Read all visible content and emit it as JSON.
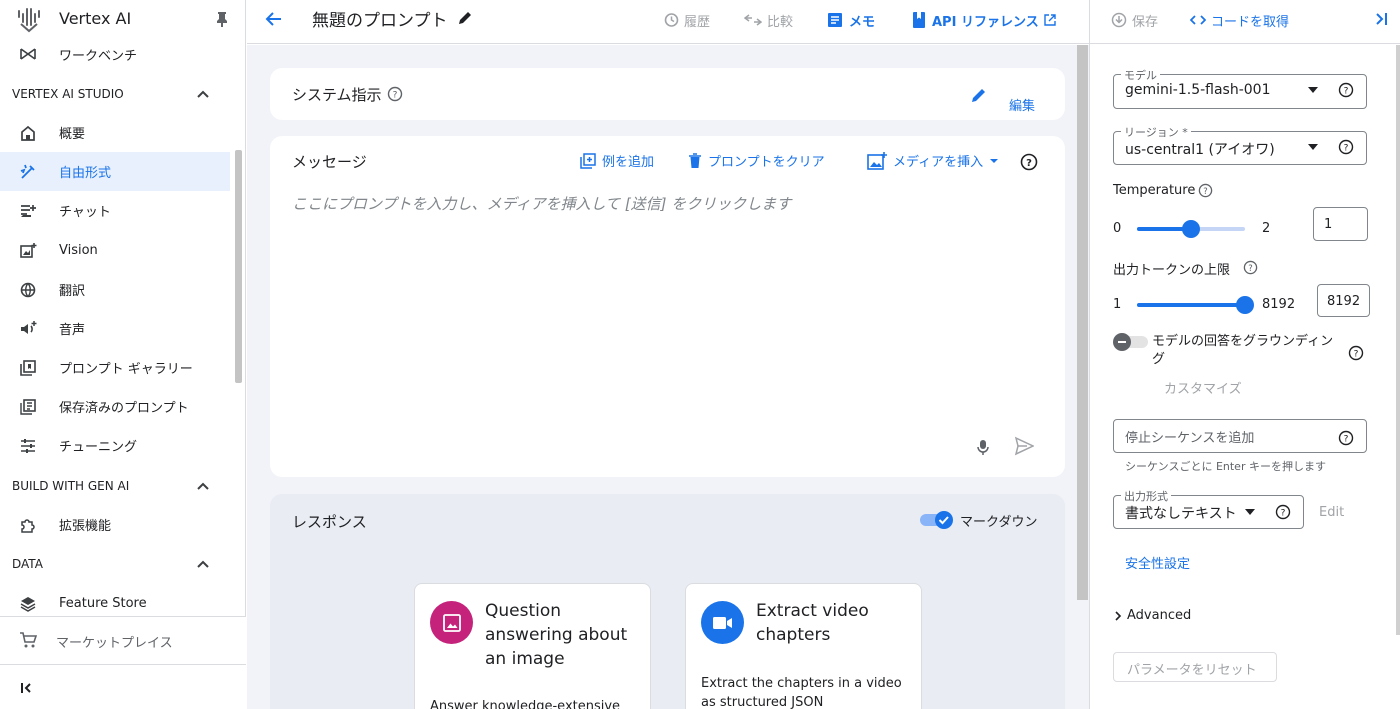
{
  "sidebar": {
    "title": "Vertex AI",
    "items_top": [
      {
        "label": "ワークベンチ",
        "icon": "workbench-icon"
      }
    ],
    "section_studio": "VERTEX AI STUDIO",
    "studio_items": [
      {
        "label": "概要",
        "icon": "home-icon"
      },
      {
        "label": "自由形式",
        "icon": "freeform-icon"
      },
      {
        "label": "チャット",
        "icon": "chat-icon"
      },
      {
        "label": "Vision",
        "icon": "vision-icon"
      },
      {
        "label": "翻訳",
        "icon": "translate-icon"
      },
      {
        "label": "音声",
        "icon": "speech-icon"
      },
      {
        "label": "プロンプト ギャラリー",
        "icon": "gallery-icon"
      },
      {
        "label": "保存済みのプロンプト",
        "icon": "saved-prompts-icon"
      },
      {
        "label": "チューニング",
        "icon": "tuning-icon"
      }
    ],
    "section_build": "BUILD WITH GEN AI",
    "build_items": [
      {
        "label": "拡張機能",
        "icon": "extensions-icon"
      }
    ],
    "section_data": "DATA",
    "data_items": [
      {
        "label": "Feature Store",
        "icon": "feature-store-icon"
      }
    ],
    "marketplace": "マーケットプレイス"
  },
  "topbar": {
    "title": "無題のプロンプト",
    "history": "履歴",
    "compare": "比較",
    "memo": "メモ",
    "api_ref": "API リファレンス",
    "save": "保存",
    "get_code": "コードを取得"
  },
  "system": {
    "label": "システム指示",
    "edit": "編集"
  },
  "message": {
    "label": "メッセージ",
    "add_example": "例を追加",
    "clear_prompt": "プロンプトをクリア",
    "insert_media": "メディアを挿入",
    "placeholder": "ここにプロンプトを入力し、メディアを挿入して [送信] をクリックします"
  },
  "response": {
    "label": "レスポンス",
    "markdown": "マークダウン",
    "markdown_on": true,
    "suggestions": [
      {
        "title": "Question answering about an image",
        "desc": "Answer knowledge-extensive",
        "color": "#c5227b",
        "icon": "image-icon"
      },
      {
        "title": "Extract video chapters",
        "desc": "Extract the chapters in a video as structured JSON",
        "color": "#1a73e8",
        "icon": "video-icon"
      }
    ]
  },
  "params": {
    "model_label": "モデル",
    "model_value": "gemini-1.5-flash-001",
    "region_label": "リージョン *",
    "region_value": "us-central1 (アイオワ)",
    "temperature_label": "Temperature",
    "temperature_min": "0",
    "temperature_max": "2",
    "temperature_value": "1",
    "temperature_fraction": 0.5,
    "tokens_label": "出力トークンの上限",
    "tokens_min": "1",
    "tokens_max": "8192",
    "tokens_value": "8192",
    "tokens_fraction": 1.0,
    "grounding_label": "モデルの回答をグラウンディング",
    "grounding_on": false,
    "customize": "カスタマイズ",
    "stop_placeholder": "停止シーケンスを追加",
    "stop_hint": "シーケンスごとに Enter キーを押します",
    "format_label": "出力形式",
    "format_value": "書式なしテキスト",
    "format_edit": "Edit",
    "safety": "安全性設定",
    "advanced": "Advanced",
    "reset": "パラメータをリセット"
  },
  "colors": {
    "accent": "#1a73e8",
    "main_bg": "#f1f3f9"
  }
}
